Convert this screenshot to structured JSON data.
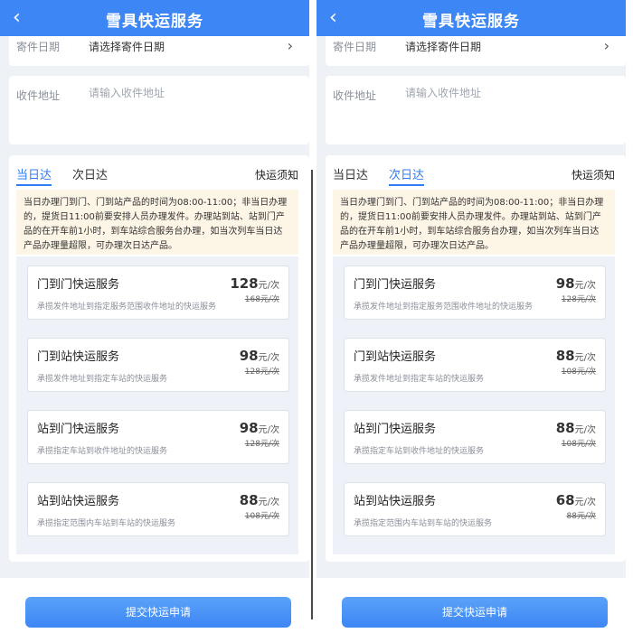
{
  "panels": [
    {
      "header_title": "雪具快运服务",
      "date_label": "寄件日期",
      "date_value": "请选择寄件日期",
      "address_label": "收件地址",
      "address_placeholder": "请输入收件地址",
      "tabs": [
        "当日达",
        "次日达"
      ],
      "active_tab": "当日达",
      "notice_link": "快运须知",
      "notice_text": "当日办理门到门、门到站产品的时间为08:00-11:00；非当日办理的，提货日11:00前要安排人员办理发件。办理站到站、站到门产品的在开车前1小时，到车站综合服务台办理，如当次列车当日达产品办理量超限，可办理次日达产品。",
      "services": [
        {
          "title": "门到门快运服务",
          "desc": "承揽发件地址到指定服务范围收件地址的快运服务",
          "price": "128",
          "old_price": "168元/次"
        },
        {
          "title": "门到站快运服务",
          "desc": "承揽发件地址到指定车站的快运服务",
          "price": "98",
          "old_price": "128元/次"
        },
        {
          "title": "站到门快运服务",
          "desc": "承揽指定车站到收件地址的快运服务",
          "price": "98",
          "old_price": "128元/次"
        },
        {
          "title": "站到站快运服务",
          "desc": "承揽指定范围内车站到车站的快运服务",
          "price": "88",
          "old_price": "108元/次"
        }
      ],
      "price_unit": "元/次",
      "submit_label": "提交快运申请"
    },
    {
      "header_title": "雪具快运服务",
      "date_label": "寄件日期",
      "date_value": "请选择寄件日期",
      "address_label": "收件地址",
      "address_placeholder": "请输入收件地址",
      "tabs": [
        "当日达",
        "次日达"
      ],
      "active_tab": "次日达",
      "notice_link": "快运须知",
      "notice_text": "当日办理门到门、门到站产品的时间为08:00-11:00；非当日办理的，提货日11:00前要安排人员办理发件。办理站到站、站到门产品的在开车前1小时，到车站综合服务台办理，如当次列车当日达产品办理量超限，可办理次日达产品。",
      "services": [
        {
          "title": "门到门快运服务",
          "desc": "承揽发件地址到指定服务范围收件地址的快运服务",
          "price": "98",
          "old_price": "128元/次"
        },
        {
          "title": "门到站快运服务",
          "desc": "承揽发件地址到指定车站的快运服务",
          "price": "88",
          "old_price": "108元/次"
        },
        {
          "title": "站到门快运服务",
          "desc": "承揽指定车站到收件地址的快运服务",
          "price": "88",
          "old_price": "108元/次"
        },
        {
          "title": "站到站快运服务",
          "desc": "承揽指定范围内车站到车站的快运服务",
          "price": "68",
          "old_price": "88元/次"
        }
      ],
      "price_unit": "元/次",
      "submit_label": "提交快运申请"
    }
  ],
  "icons": {
    "back": "chevron-left-icon",
    "forward": "chevron-right-icon"
  },
  "colors": {
    "header": "#3d86f5",
    "active_tab": "#2f7cf6",
    "notice_bg": "#fdf5e6"
  }
}
